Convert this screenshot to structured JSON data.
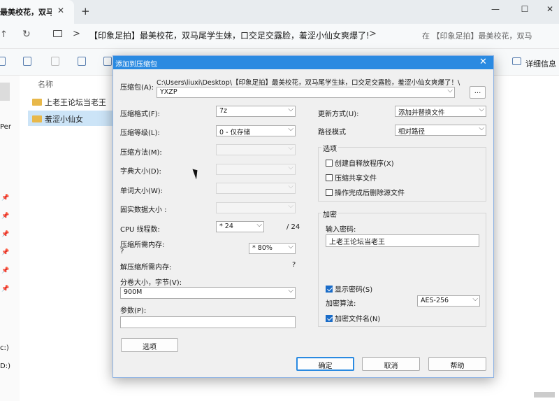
{
  "browser": {
    "tab_title": "最美校花，双马尾",
    "tab_close": "✕",
    "new_tab": "+",
    "window_controls": {
      "minimize": "—",
      "maximize": "☐",
      "close": "✕"
    },
    "nav_up": "↑",
    "nav_refresh": "↻",
    "address_sep": ">",
    "address_text": "【印象足拍】最美校花，双马尾学生妹，口交足交露脸，羞涩小仙女爽爆了!",
    "search_text": "在 【印象足拍】最美校花，双马"
  },
  "toolbar": {
    "details_label": "详细信息"
  },
  "sidebar": {
    "per_text": "Per",
    "drive_c": "c:)",
    "drive_d": "D:)",
    "pin": "📌"
  },
  "filelist": {
    "column_name": "名称",
    "items": [
      {
        "name": "上老王论坛当老王",
        "selected": false
      },
      {
        "name": "羞涩小仙女",
        "selected": true
      }
    ]
  },
  "dialog": {
    "title": "添加到压缩包",
    "close": "✕",
    "archive_label": "压缩包(A):",
    "archive_path": "C:\\Users\\liuxi\\Desktop\\【印象足拍】最美校花，双马尾学生妹，口交足交露脸，羞涩小仙女爽爆了！\\",
    "archive_name": "YXZP",
    "browse_button": "...",
    "format_label": "压缩格式(F):",
    "format_value": "7z",
    "level_label": "压缩等级(L):",
    "level_value": "0 - 仅存储",
    "method_label": "压缩方法(M):",
    "dict_label": "字典大小(D):",
    "word_label": "单词大小(W):",
    "solid_label": "固实数据大小 :",
    "cpu_label": "CPU 线程数:",
    "cpu_value": "* 24",
    "cpu_total": "/ 24",
    "mem_comp_label": "压缩所需内存:",
    "mem_comp_q": "?",
    "mem_value": "* 80%",
    "mem_decomp_label": "解压缩所需内存:",
    "mem_decomp_q": "?",
    "volume_label": "分卷大小，字节(V):",
    "volume_value": "900M",
    "params_label": "参数(P):",
    "params_value": "",
    "options_button": "选项",
    "update_label": "更新方式(U):",
    "update_value": "添加并替换文件",
    "path_label": "路径模式",
    "path_value": "相对路径",
    "options_group": "选项",
    "opt_sfx": "创建自释放程序(X)",
    "opt_shared": "压缩共享文件",
    "opt_delete": "操作完成后删除源文件",
    "encrypt_group": "加密",
    "password_label": "输入密码:",
    "password_value": "上老王论坛当老王",
    "show_password": "显示密码(S)",
    "enc_method_label": "加密算法:",
    "enc_method_value": "AES-256",
    "encrypt_names": "加密文件名(N)",
    "ok_button": "确定",
    "cancel_button": "取消",
    "help_button": "帮助",
    "dropdown_arrow": "⌵"
  }
}
